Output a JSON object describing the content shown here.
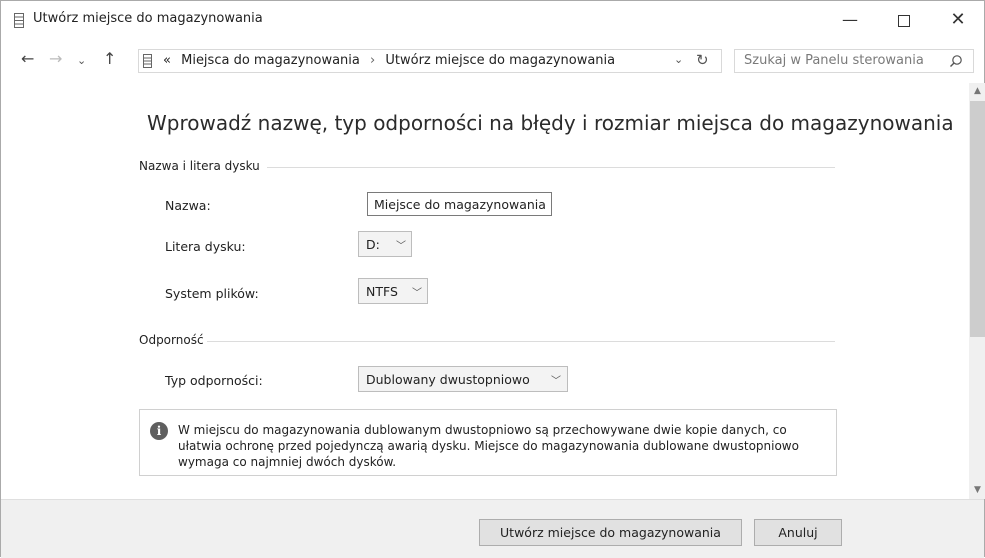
{
  "window": {
    "title": "Utwórz miejsce do magazynowania",
    "icon": "storage-icon",
    "controls": {
      "minimize": "—",
      "close": "✕"
    }
  },
  "nav": {
    "back": "←",
    "forward": "→",
    "recent": "⌄",
    "up": "↑",
    "address": {
      "prefix": "«",
      "crumbs": [
        "Miejsca do magazynowania",
        "Utwórz miejsce do magazynowania"
      ],
      "separator": "›",
      "dropdown": "⌄",
      "refresh": "↻"
    },
    "search": {
      "placeholder": "Szukaj w Panelu sterowania"
    }
  },
  "main": {
    "heading": "Wprowadź nazwę, typ odporności na błędy i rozmiar miejsca do magazynowania",
    "group_name": {
      "label": "Nazwa i litera dysku",
      "name_label": "Nazwa:",
      "name_value": "Miejsce do magazynowania",
      "letter_label": "Litera dysku:",
      "letter_value": "D:",
      "fs_label": "System plików:",
      "fs_value": "NTFS"
    },
    "group_resiliency": {
      "label": "Odporność",
      "type_label": "Typ odporności:",
      "type_value": "Dublowany dwustopniowo"
    },
    "info": {
      "icon": "i",
      "text": "W miejscu do magazynowania dublowanym dwustopniowo są przechowywane dwie kopie danych, co ułatwia ochronę przed pojedynczą awarią dysku. Miejsce do magazynowania dublowane dwustopniowo wymaga co najmniej dwóch dysków."
    }
  },
  "scroll": {
    "up": "▲",
    "down": "▼"
  },
  "footer": {
    "create_label": "Utwórz miejsce do magazynowania",
    "cancel_label": "Anuluj"
  },
  "colors": {
    "footer_bg": "#f0f0f0",
    "info_icon": "#5f5f5f"
  }
}
